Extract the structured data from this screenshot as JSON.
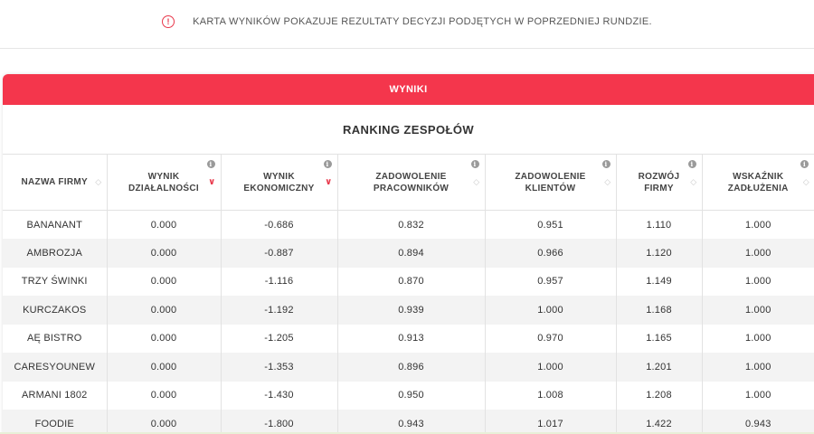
{
  "notice": {
    "icon": "info-circle-icon",
    "text": "KARTA WYNIKÓW POKAZUJE REZULTATY DECYZJI PODJĘTYCH W POPRZEDNIEJ RUNDZIE."
  },
  "card": {
    "header": "WYNIKI",
    "title": "RANKING ZESPOŁÓW"
  },
  "colors": {
    "accent": "#f4364c",
    "icon_red": "#e8374a"
  },
  "table": {
    "columns": [
      {
        "key": "name",
        "label": "NAZWA FIRMY",
        "info": false,
        "sort": "none"
      },
      {
        "key": "operating_result",
        "label": "WYNIK DZIAŁALNOŚCI",
        "info": true,
        "sort": "desc"
      },
      {
        "key": "economic_result",
        "label": "WYNIK EKONOMICZNY",
        "info": true,
        "sort": "desc"
      },
      {
        "key": "employee_satisfaction",
        "label": "ZADOWOLENIE PRACOWNIKÓW",
        "info": true,
        "sort": "none"
      },
      {
        "key": "customer_satisfaction",
        "label": "ZADOWOLENIE KLIENTÓW",
        "info": true,
        "sort": "none"
      },
      {
        "key": "company_growth",
        "label": "ROZWÓJ FIRMY",
        "info": true,
        "sort": "none"
      },
      {
        "key": "debt_ratio",
        "label": "WSKAŹNIK ZADŁUŻENIA",
        "info": true,
        "sort": "none"
      }
    ],
    "rows": [
      [
        "BANANANT",
        "0.000",
        "-0.686",
        "0.832",
        "0.951",
        "1.110",
        "1.000"
      ],
      [
        "AMBROZJA",
        "0.000",
        "-0.887",
        "0.894",
        "0.966",
        "1.120",
        "1.000"
      ],
      [
        "TRZY ŚWINKI",
        "0.000",
        "-1.116",
        "0.870",
        "0.957",
        "1.149",
        "1.000"
      ],
      [
        "KURCZAKOS",
        "0.000",
        "-1.192",
        "0.939",
        "1.000",
        "1.168",
        "1.000"
      ],
      [
        "AĘ BISTRO",
        "0.000",
        "-1.205",
        "0.913",
        "0.970",
        "1.165",
        "1.000"
      ],
      [
        "CARESYOUNEW",
        "0.000",
        "-1.353",
        "0.896",
        "1.000",
        "1.201",
        "1.000"
      ],
      [
        "ARMANI 1802",
        "0.000",
        "-1.430",
        "0.950",
        "1.008",
        "1.208",
        "1.000"
      ],
      [
        "FOODIE",
        "0.000",
        "-1.800",
        "0.943",
        "1.017",
        "1.422",
        "0.943"
      ]
    ]
  }
}
